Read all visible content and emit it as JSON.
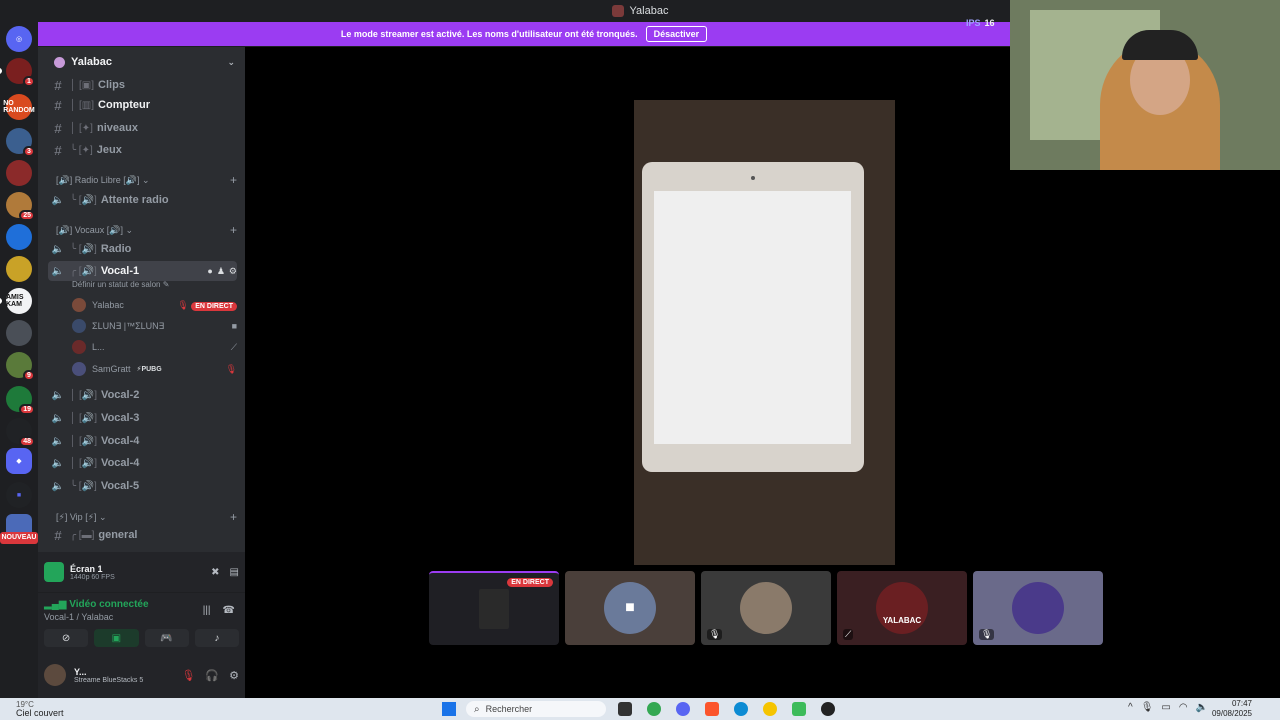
{
  "window": {
    "title": "Yalabac"
  },
  "servers": [
    {
      "label": "",
      "color": "#5865f2",
      "badge": ""
    },
    {
      "label": "",
      "color": "#7a1f1f",
      "badge": "1"
    },
    {
      "label": "NO RANDOM",
      "color": "#d94a1f",
      "badge": ""
    },
    {
      "label": "",
      "color": "#3b5f8f",
      "badge": "3"
    },
    {
      "label": "",
      "color": "#8b2a2a",
      "badge": ""
    },
    {
      "label": "",
      "color": "#b07a3a",
      "badge": "25"
    },
    {
      "label": "",
      "color": "#1f6fd9",
      "badge": ""
    },
    {
      "label": "",
      "color": "#c9a227",
      "badge": ""
    },
    {
      "label": "AMIS KAM",
      "color": "#f2f3f5",
      "badge": ""
    },
    {
      "label": "",
      "color": "#4a4f57",
      "badge": ""
    },
    {
      "label": "",
      "color": "#5a7a3a",
      "badge": "9"
    },
    {
      "label": "",
      "color": "#1e7a3a",
      "badge": "19"
    },
    {
      "label": "",
      "color": "#202225",
      "badge": "48"
    },
    {
      "label": "",
      "color": "#5865f2",
      "badge": ""
    },
    {
      "label": "",
      "color": "#5865f2",
      "badge": ""
    },
    {
      "label": "",
      "color": "#4b6ab8",
      "badge": ""
    }
  ],
  "new_label": "NOUVEAU",
  "banner": {
    "text": "Le mode streamer est activé. Les noms d'utilisateur ont été tronqués.",
    "button": "Désactiver"
  },
  "ips": {
    "label": "IPS",
    "value": "16"
  },
  "guild": {
    "name": "Yalabac"
  },
  "channels": {
    "clips": "Clips",
    "compteur": "Compteur",
    "niveaux": "niveaux",
    "jeux": "Jeux",
    "cat_radio": "Radio Libre",
    "attente": "Attente radio",
    "cat_vocaux": "Vocaux",
    "radio": "Radio",
    "vocal1": "Vocal-1",
    "vocal1_status": "Définir un statut de salon",
    "vocal2": "Vocal-2",
    "vocal3": "Vocal-3",
    "vocal4a": "Vocal-4",
    "vocal4b": "Vocal-4",
    "vocal5": "Vocal-5",
    "cat_vip": "Vip",
    "general": "general"
  },
  "members": [
    {
      "name": "Yalabac",
      "extra": "EN DIRECT",
      "color": "#7a4a3a"
    },
    {
      "name": "ΣLUN∃ |™ΣLUN∃",
      "extra": "",
      "color": "#3a4a6a"
    },
    {
      "name": "L...",
      "extra": "",
      "color": "#6a2a2a"
    },
    {
      "name": "SamGratt",
      "extra": "PUBG",
      "color": "#4a4f7a"
    }
  ],
  "screen_panel": {
    "title": "Écran 1",
    "quality": "1440p 60 FPS"
  },
  "voice_panel": {
    "status": "Vidéo connectée",
    "channel": "Vocal-1 / Yalabac"
  },
  "user_panel": {
    "name": "Y...",
    "status": "Streame BlueStacks 5"
  },
  "tiles": [
    {
      "live": "EN DIRECT",
      "color": "#1f1f24",
      "label": ""
    },
    {
      "live": "",
      "color": "#4a3f3a",
      "label": ""
    },
    {
      "live": "",
      "color": "#3a3a3a",
      "label": ""
    },
    {
      "live": "",
      "color": "#3a1f22",
      "label": "YALABAC"
    },
    {
      "live": "",
      "color": "#6a6a8a",
      "label": ""
    }
  ],
  "taskbar": {
    "weather_temp": "19°C",
    "weather_text": "Ciel couvert",
    "search_placeholder": "Rechercher",
    "time": "07:47",
    "date": "09/08/2025"
  },
  "colors": {
    "accent": "#5865f2",
    "streamer_banner": "#9b3cf2",
    "live": "#da373c",
    "connected": "#23a55a"
  }
}
